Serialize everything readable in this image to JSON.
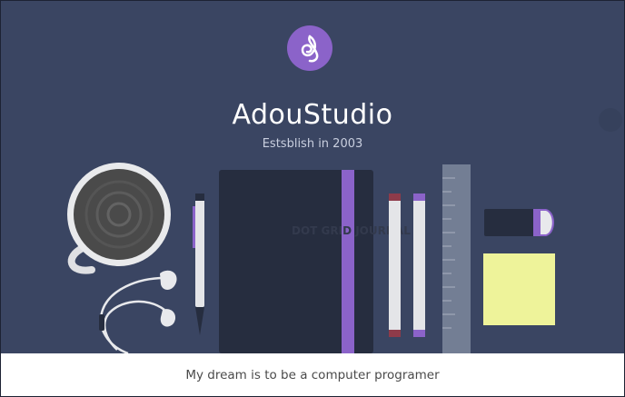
{
  "hero": {
    "title": "AdouStudio",
    "subtitle": "Estsblish in 2003"
  },
  "journal": {
    "cover_text": "DOT GRID JOURNAL"
  },
  "footer": {
    "text": "My dream is to be a computer programer"
  },
  "colors": {
    "background": "#3a4562",
    "accent_purple": "#8b63c9",
    "notebook": "#262d3f",
    "sticky_note": "#eef39a",
    "footer_bg": "#ffffff"
  },
  "icons": [
    "studio-logo-icon"
  ]
}
